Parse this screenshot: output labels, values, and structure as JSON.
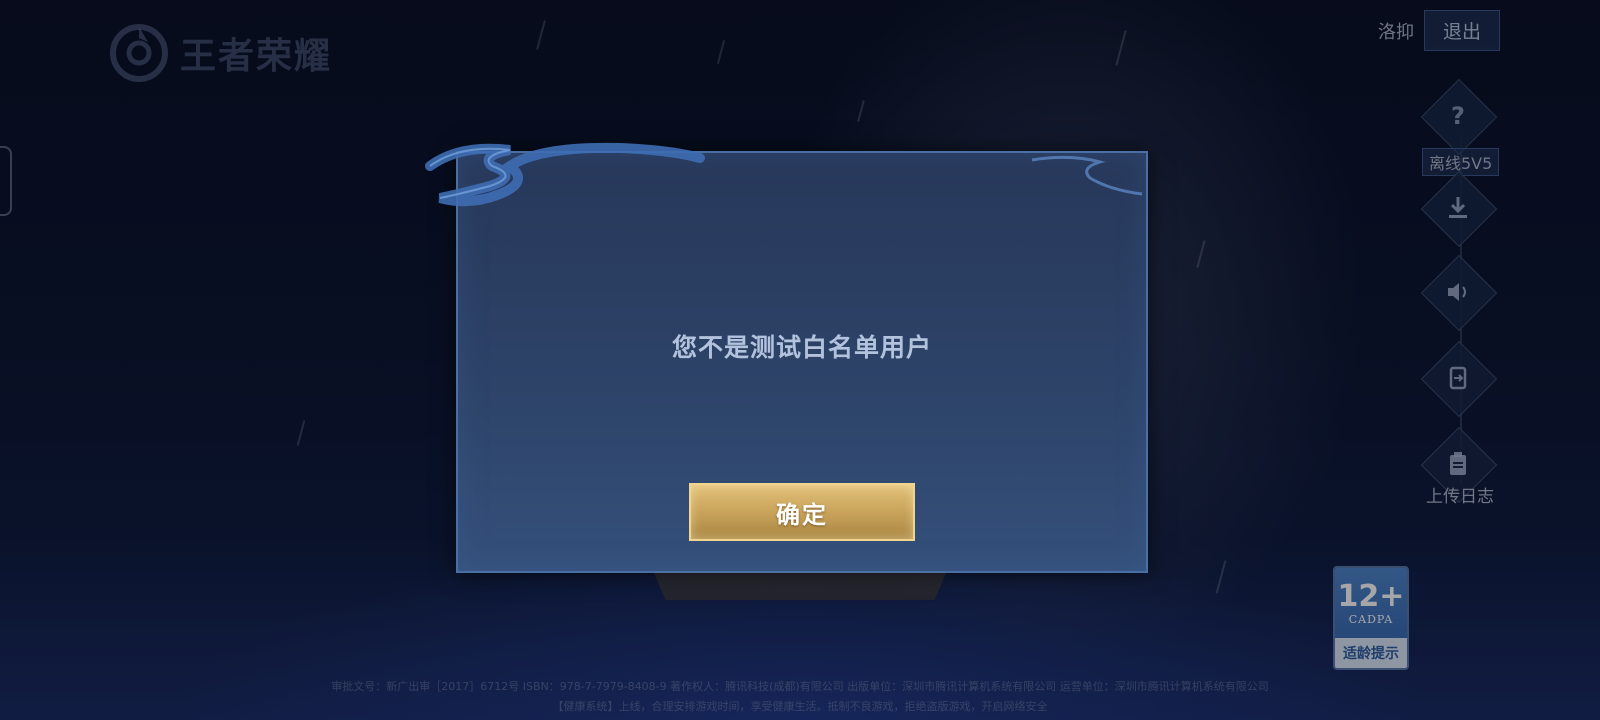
{
  "app": {
    "logo_text": "王者荣耀"
  },
  "header": {
    "username": "洛抑",
    "logout_label": "退出"
  },
  "side_menu": {
    "offline_5v5_label": "离线5V5",
    "upload_log_label": "上传日志"
  },
  "age_rating": {
    "age": "12+",
    "org": "CADPA",
    "caption": "适龄提示"
  },
  "footer": {
    "line1": "审批文号：新广出审［2017］6712号 ISBN：978-7-7979-8408-9 著作权人：腾讯科技(成都)有限公司 出版单位：深圳市腾讯计算机系统有限公司 运营单位：深圳市腾讯计算机系统有限公司",
    "line2": "【健康系统】上线，合理安排游戏时间，享受健康生活。抵制不良游戏，拒绝盗版游戏，开启网络安全"
  },
  "dialog": {
    "message": "您不是测试白名单用户",
    "confirm_label": "确定"
  },
  "icons": {
    "help": "question-icon",
    "download": "download-icon",
    "sound": "speaker-icon",
    "switch": "switch-account-icon",
    "log": "clipboard-icon"
  },
  "colors": {
    "dialog_bg": "#2d4368",
    "dialog_border": "#4a6fa3",
    "confirm_gold": "#c9a35a",
    "message_text": "#b3c3de"
  }
}
